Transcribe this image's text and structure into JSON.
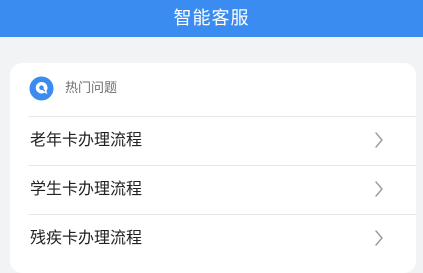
{
  "header": {
    "title": "智能客服"
  },
  "faq": {
    "title": "热门问题",
    "icon": "question-bubble-icon",
    "items": [
      {
        "label": "老年卡办理流程",
        "icon": "chevron-right-icon"
      },
      {
        "label": "学生卡办理流程",
        "icon": "chevron-right-icon"
      },
      {
        "label": "残疾卡办理流程",
        "icon": "chevron-right-icon"
      }
    ]
  },
  "colors": {
    "header_bg": "#3b8cf0",
    "page_bg": "#f2f3f5",
    "icon_blue": "#3b8cf0",
    "text_primary": "#222222",
    "text_secondary": "#6e6e6e"
  }
}
